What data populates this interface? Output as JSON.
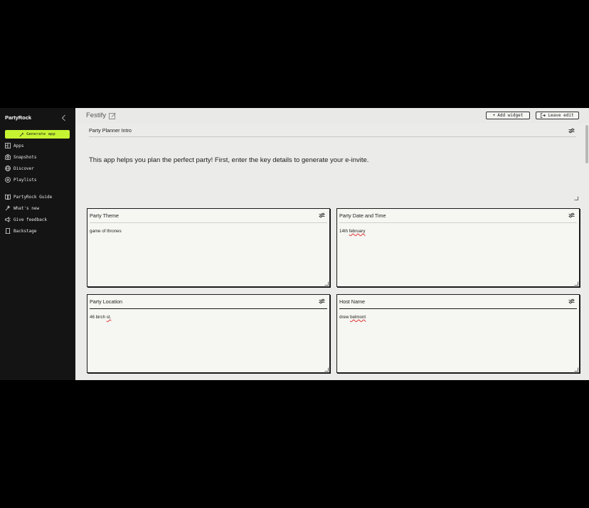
{
  "sidebar": {
    "brand": "PartyRock",
    "generate_label": "Generate app",
    "items": [
      {
        "label": "Apps",
        "icon": "apps-icon"
      },
      {
        "label": "Snapshots",
        "icon": "camera-icon"
      },
      {
        "label": "Discover",
        "icon": "globe-icon"
      },
      {
        "label": "Playlists",
        "icon": "playlist-icon"
      },
      {
        "label": "PartyRock Guide",
        "icon": "book-icon"
      },
      {
        "label": "What's new",
        "icon": "sparkle-icon"
      },
      {
        "label": "Give feedback",
        "icon": "megaphone-icon"
      },
      {
        "label": "Backstage",
        "icon": "bookmark-icon"
      }
    ]
  },
  "header": {
    "app_title": "Festify",
    "add_widget_label": "Add widget",
    "leave_edit_label": "Leave edit"
  },
  "intro": {
    "title": "Party Planner Intro",
    "text": "This app helps you plan the perfect party! First, enter the key details to generate your e-invite."
  },
  "widgets": [
    {
      "title": "Party Theme",
      "value": "game of thrones"
    },
    {
      "title": "Party Date and Time",
      "value_a": "14th ",
      "value_b": "february"
    },
    {
      "title": "Party Location",
      "value_a": "46 birch ",
      "value_b": "st."
    },
    {
      "title": "Host Name",
      "value_a": "drew ",
      "value_b": "belmont"
    }
  ],
  "colors": {
    "accent": "#c6f432",
    "sidebar_bg": "#141414",
    "card_bg": "#f6f6f2"
  }
}
